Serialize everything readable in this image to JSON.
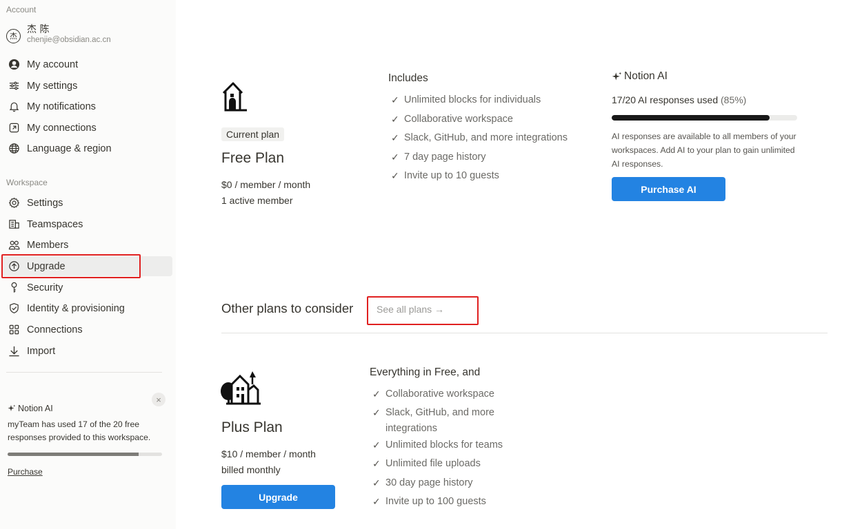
{
  "sidebar": {
    "account_label": "Account",
    "user": {
      "avatar": "杰",
      "name": "杰 陈",
      "email": "chenjie@obsidian.ac.cn"
    },
    "account_items": [
      {
        "label": "My account",
        "icon": "user-circle-icon"
      },
      {
        "label": "My settings",
        "icon": "sliders-icon"
      },
      {
        "label": "My notifications",
        "icon": "bell-icon"
      },
      {
        "label": "My connections",
        "icon": "external-link-icon"
      },
      {
        "label": "Language & region",
        "icon": "globe-icon"
      }
    ],
    "workspace_label": "Workspace",
    "workspace_items": [
      {
        "label": "Settings",
        "icon": "gear-icon"
      },
      {
        "label": "Teamspaces",
        "icon": "building-icon"
      },
      {
        "label": "Members",
        "icon": "people-icon"
      },
      {
        "label": "Upgrade",
        "icon": "arrow-up-circle-icon",
        "active": true
      },
      {
        "label": "Security",
        "icon": "key-icon"
      },
      {
        "label": "Identity & provisioning",
        "icon": "shield-check-icon"
      },
      {
        "label": "Connections",
        "icon": "grid-icon"
      },
      {
        "label": "Import",
        "icon": "download-icon"
      }
    ],
    "ai_card": {
      "close": "×",
      "title": "Notion AI",
      "text": "myTeam has used 17 of the 20 free responses provided to this workspace.",
      "used_fraction": 0.85,
      "link": "Purchase"
    }
  },
  "current_plan": {
    "badge": "Current plan",
    "name": "Free Plan",
    "price": "$0 / member / month",
    "members": "1 active member",
    "includes_title": "Includes",
    "features": [
      "Unlimited blocks for individuals",
      "Collaborative workspace",
      "Slack, GitHub, and more integrations",
      "7 day page history",
      "Invite up to 10 guests"
    ]
  },
  "notion_ai": {
    "title": "Notion AI",
    "used": "17/20 AI responses used",
    "percent": "(85%)",
    "used_fraction": 0.85,
    "description": "AI responses are available to all members of your workspaces. Add AI to your plan to gain unlimited AI responses.",
    "button": "Purchase AI"
  },
  "other_plans": {
    "title": "Other plans to consider",
    "see_all": "See all plans →"
  },
  "plus_plan": {
    "name": "Plus Plan",
    "price": "$10 / member / month",
    "billing": "billed monthly",
    "button": "Upgrade",
    "includes_title": "Everything in Free, and",
    "features": [
      "Collaborative workspace",
      "Slack, GitHub, and more integrations",
      "Unlimited blocks for teams",
      "Unlimited file uploads",
      "30 day page history",
      "Invite up to 100 guests"
    ]
  },
  "colors": {
    "accent": "#2383e2",
    "highlight": "#e02020",
    "active_bg": "#ededec",
    "text": "#37352f"
  }
}
